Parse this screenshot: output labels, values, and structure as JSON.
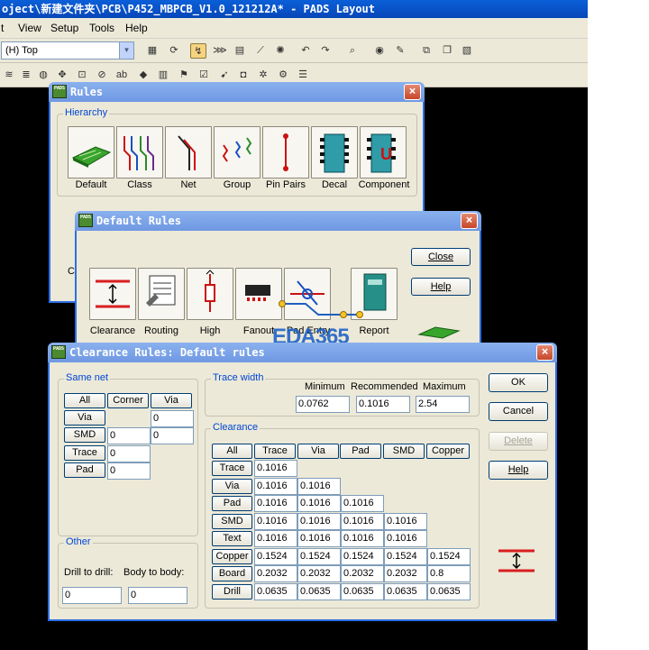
{
  "app": {
    "title": "oject\\新建文件夹\\PCB\\P452_MBPCB_V1.0_121212A* - PADS Layout",
    "menu": [
      "t",
      "View",
      "Setup",
      "Tools",
      "Help"
    ],
    "layer": "(H) Top"
  },
  "rules_dialog": {
    "title": "Rules",
    "group_label": "Hierarchy",
    "buttons": [
      "Default",
      "Class",
      "Net",
      "Group",
      "Pin Pairs",
      "Decal",
      "Component"
    ],
    "partial_label": "C"
  },
  "default_rules_dialog": {
    "title": "Default Rules",
    "buttons": [
      "Clearance",
      "Routing",
      "High",
      "Fanout",
      "Pad Entry",
      "Report"
    ],
    "close_label": "Close",
    "help_label": "Help"
  },
  "clearance_dialog": {
    "title": "Clearance Rules: Default rules",
    "same_net": {
      "label": "Same net",
      "headers": [
        "All",
        "Corner",
        "Via"
      ],
      "rows": [
        {
          "label": "Via",
          "values": [
            "",
            "0"
          ]
        },
        {
          "label": "SMD",
          "values": [
            "0",
            "0"
          ]
        },
        {
          "label": "Trace",
          "values": [
            "0"
          ]
        },
        {
          "label": "Pad",
          "values": [
            "0"
          ]
        }
      ]
    },
    "other": {
      "label": "Other",
      "drill_label": "Drill to drill:",
      "body_label": "Body to body:",
      "drill_value": "0",
      "body_value": "0"
    },
    "trace_width": {
      "label": "Trace width",
      "headers": [
        "Minimum",
        "Recommended",
        "Maximum"
      ],
      "values": [
        "0.0762",
        "0.1016",
        "2.54"
      ]
    },
    "clearance": {
      "label": "Clearance",
      "headers": [
        "All",
        "Trace",
        "Via",
        "Pad",
        "SMD",
        "Copper"
      ],
      "rows": [
        {
          "label": "Trace",
          "values": [
            "0.1016"
          ]
        },
        {
          "label": "Via",
          "values": [
            "0.1016",
            "0.1016"
          ]
        },
        {
          "label": "Pad",
          "values": [
            "0.1016",
            "0.1016",
            "0.1016"
          ]
        },
        {
          "label": "SMD",
          "values": [
            "0.1016",
            "0.1016",
            "0.1016",
            "0.1016"
          ]
        },
        {
          "label": "Text",
          "values": [
            "0.1016",
            "0.1016",
            "0.1016",
            "0.1016"
          ]
        },
        {
          "label": "Copper",
          "values": [
            "0.1524",
            "0.1524",
            "0.1524",
            "0.1524",
            "0.1524"
          ]
        },
        {
          "label": "Board",
          "values": [
            "0.2032",
            "0.2032",
            "0.2032",
            "0.2032",
            "0.8"
          ]
        },
        {
          "label": "Drill",
          "values": [
            "0.0635",
            "0.0635",
            "0.0635",
            "0.0635",
            "0.0635"
          ]
        }
      ]
    },
    "buttons": {
      "ok": "OK",
      "cancel": "Cancel",
      "delete": "Delete",
      "help": "Help"
    }
  },
  "watermark": "EDA365",
  "colors": {
    "title_blue": "#0a5fd8",
    "dialog_face": "#ece9d8",
    "clearance_red": "#d71f1f"
  }
}
